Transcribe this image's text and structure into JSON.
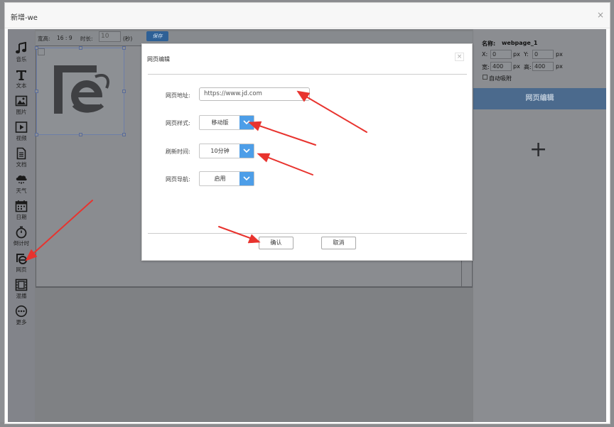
{
  "window": {
    "title": "新增-we",
    "close_icon": "×"
  },
  "topbar": {
    "ratio_label": "宽高:",
    "ratio_value": "16 : 9",
    "duration_label": "时长:",
    "duration_value": "10",
    "duration_unit": "(秒)",
    "save_label": "保存"
  },
  "toolbar": {
    "items": [
      {
        "label": "音乐",
        "icon": "music-icon"
      },
      {
        "label": "文本",
        "icon": "text-icon"
      },
      {
        "label": "图片",
        "icon": "image-icon"
      },
      {
        "label": "视频",
        "icon": "video-icon"
      },
      {
        "label": "文档",
        "icon": "document-icon"
      },
      {
        "label": "天气",
        "icon": "weather-icon"
      },
      {
        "label": "日期",
        "icon": "calendar-icon"
      },
      {
        "label": "倒计时",
        "icon": "timer-icon"
      },
      {
        "label": "网页",
        "icon": "webpage-icon"
      },
      {
        "label": "混播",
        "icon": "film-icon"
      },
      {
        "label": "更多",
        "icon": "more-icon"
      }
    ]
  },
  "right_panel": {
    "name_label": "名称:",
    "name_value": "webpage_1",
    "x_label": "X:",
    "x_value": "0",
    "y_label": "Y:",
    "y_value": "0",
    "unit": "px",
    "width_label": "宽:",
    "width_value": "400",
    "height_label": "高:",
    "height_value": "400",
    "snap_label": "自动吸附",
    "edit_button": "网页编辑",
    "add_icon": "+"
  },
  "dialog": {
    "title": "网页编辑",
    "close_icon": "×",
    "url_label": "网页地址:",
    "url_value": "https://www.jd.com",
    "style_label": "网页样式:",
    "style_value": "移动版",
    "refresh_label": "刷新时间:",
    "refresh_value": "10分钟",
    "nav_label": "网页导航:",
    "nav_value": "启用",
    "confirm_label": "确认",
    "cancel_label": "取消"
  },
  "colors": {
    "accent_blue": "#4d9ee8",
    "annotation_red": "#e8332e"
  }
}
